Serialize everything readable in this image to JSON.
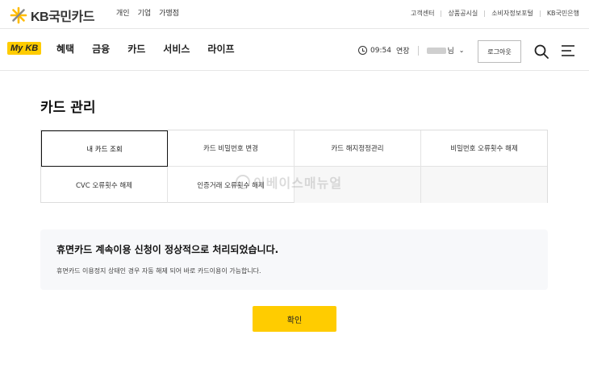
{
  "brand": {
    "logo_text": "KB국민카드",
    "mykb_label": "My KB",
    "accent_color": "#ffcc00"
  },
  "segment_tabs": [
    {
      "label": "개인",
      "active": true
    },
    {
      "label": "기업",
      "active": false
    },
    {
      "label": "가맹점",
      "active": false
    }
  ],
  "util_links": [
    "고객센터",
    "상품공시실",
    "소비자정보포털",
    "KB국민은행"
  ],
  "main_menu": [
    "혜택",
    "금융",
    "카드",
    "서비스",
    "라이프"
  ],
  "session": {
    "time": "09:54",
    "extend_label": "연장",
    "user_suffix": "님"
  },
  "logout_label": "로그아웃",
  "icons": {
    "search": "search-icon",
    "menu": "hamburger-menu-icon",
    "clock": "clock-icon",
    "chevron": "chevron-down-icon"
  },
  "page_title": "카드 관리",
  "tabs": [
    {
      "label": "내 카드 조회",
      "active": true
    },
    {
      "label": "카드 비밀번호 변경",
      "active": false
    },
    {
      "label": "카드 해지정정관리",
      "active": false
    },
    {
      "label": "비밀번호 오류횟수 해제",
      "active": false
    },
    {
      "label": "CVC 오류횟수 해제",
      "active": false
    },
    {
      "label": "인증거래 오류횟수 해제",
      "active": false
    },
    {
      "label": "",
      "active": false
    },
    {
      "label": "",
      "active": false
    }
  ],
  "watermark_text": "이베이스매뉴얼",
  "notice": {
    "title": "휴면카드 계속이용 신청이 정상적으로 처리되었습니다.",
    "description": "휴면카드 이용정지 상태인 경우 자동 해제 되어 바로 카드이용이 가능합니다."
  },
  "confirm_label": "확인"
}
